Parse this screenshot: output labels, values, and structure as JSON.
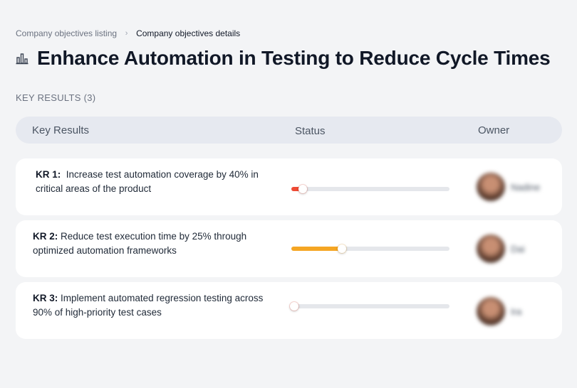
{
  "breadcrumb": {
    "parent": "Company objectives listing",
    "separator": "›",
    "current": "Company objectives details"
  },
  "page": {
    "title": "Enhance Automation in Testing to Reduce Cycle Times",
    "title_icon": "bar-chart-icon"
  },
  "section": {
    "label": "KEY RESULTS (3)"
  },
  "table": {
    "headers": {
      "key_results": "Key Results",
      "status": "Status",
      "owner": "Owner"
    }
  },
  "key_results": [
    {
      "id": "KR 1:",
      "text": "Increase test automation coverage by 40% in critical areas of the product",
      "progress": 0.07,
      "color": "#ef4b35",
      "owner": "Nadine"
    },
    {
      "id": "KR 2:",
      "text": "Reduce test execution time by 25% through optimized automation frameworks",
      "progress": 0.32,
      "color": "#f5a623",
      "owner": "Dai"
    },
    {
      "id": "KR 3:",
      "text": "Implement automated regression testing across 90% of high-priority test cases",
      "progress": 0.02,
      "color": "#ef4b35",
      "owner": "Ira"
    }
  ]
}
